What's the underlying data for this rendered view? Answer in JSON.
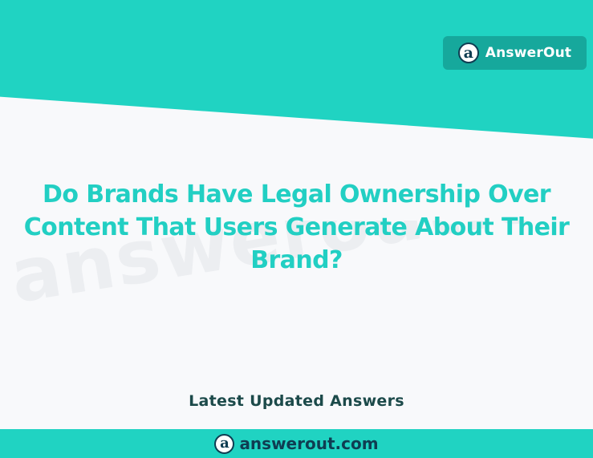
{
  "brand": {
    "name": "AnswerOut",
    "logo_letter": "a"
  },
  "watermark": {
    "text": "answerout.com"
  },
  "question": {
    "title": "Do Brands Have Legal Ownership Over Content That Users Generate About Their Brand?"
  },
  "footer": {
    "section_label": "Latest Updated Answers",
    "site": "answerout.com",
    "logo_letter": "a"
  },
  "colors": {
    "accent": "#20d3c2",
    "badge": "#16a89c",
    "title": "#22cfc3",
    "dark": "#0f3d52",
    "background": "#f8f9fb"
  },
  "icons": {
    "logo": "answerout-logo-icon"
  }
}
